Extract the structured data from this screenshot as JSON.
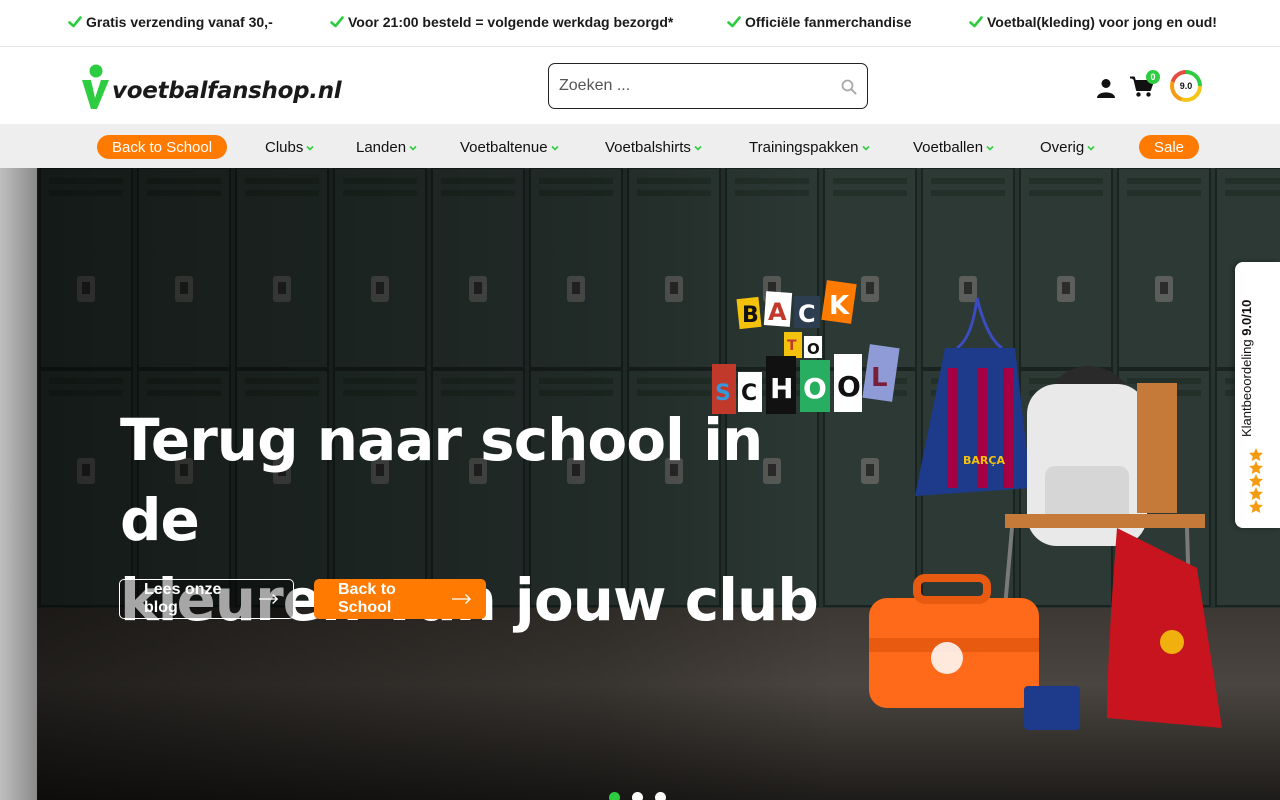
{
  "usp": [
    {
      "icon": "check-icon",
      "text": "Gratis verzending vanaf 30,-"
    },
    {
      "icon": "check-icon",
      "text": "Voor 21:00 besteld = volgende werkdag bezorgd*"
    },
    {
      "icon": "check-icon",
      "text": "Officiële fanmerchandise"
    },
    {
      "icon": "check-icon",
      "text": "Voetbal(kleding) voor jong en oud!"
    }
  ],
  "header": {
    "logo_text": "voetbalfanshop.nl",
    "search_placeholder": "Zoeken ...",
    "cart_count": "0",
    "rating_score": "9.0"
  },
  "nav": {
    "items": [
      {
        "label": "Back to School",
        "style": "pill",
        "dropdown": false
      },
      {
        "label": "Clubs",
        "dropdown": true
      },
      {
        "label": "Landen",
        "dropdown": true
      },
      {
        "label": "Voetbaltenue",
        "dropdown": true
      },
      {
        "label": "Voetbalshirts",
        "dropdown": true
      },
      {
        "label": "Trainingspakken",
        "dropdown": true
      },
      {
        "label": "Voetballen",
        "dropdown": true
      },
      {
        "label": "Overig",
        "dropdown": true
      },
      {
        "label": "Sale",
        "style": "pill",
        "dropdown": false
      }
    ]
  },
  "hero": {
    "title_line1": "Terug naar school in de",
    "title_line2": "kleuren van jouw club",
    "btn_blog": "Lees onze blog",
    "btn_school": "Back to School",
    "collage_letters": [
      "B",
      "A",
      "C",
      "K",
      "T",
      "O",
      "S",
      "C",
      "H",
      "O",
      "O",
      "L"
    ],
    "bag_label": "BARÇA",
    "slides": 3,
    "active_slide": 1
  },
  "review_tab": {
    "label": "Klantbeoordeling",
    "score": "9.0/10",
    "stars": 5
  },
  "colors": {
    "accent_green": "#2ecc40",
    "accent_orange": "#ff7a00",
    "nav_bg": "#eeeeee"
  }
}
